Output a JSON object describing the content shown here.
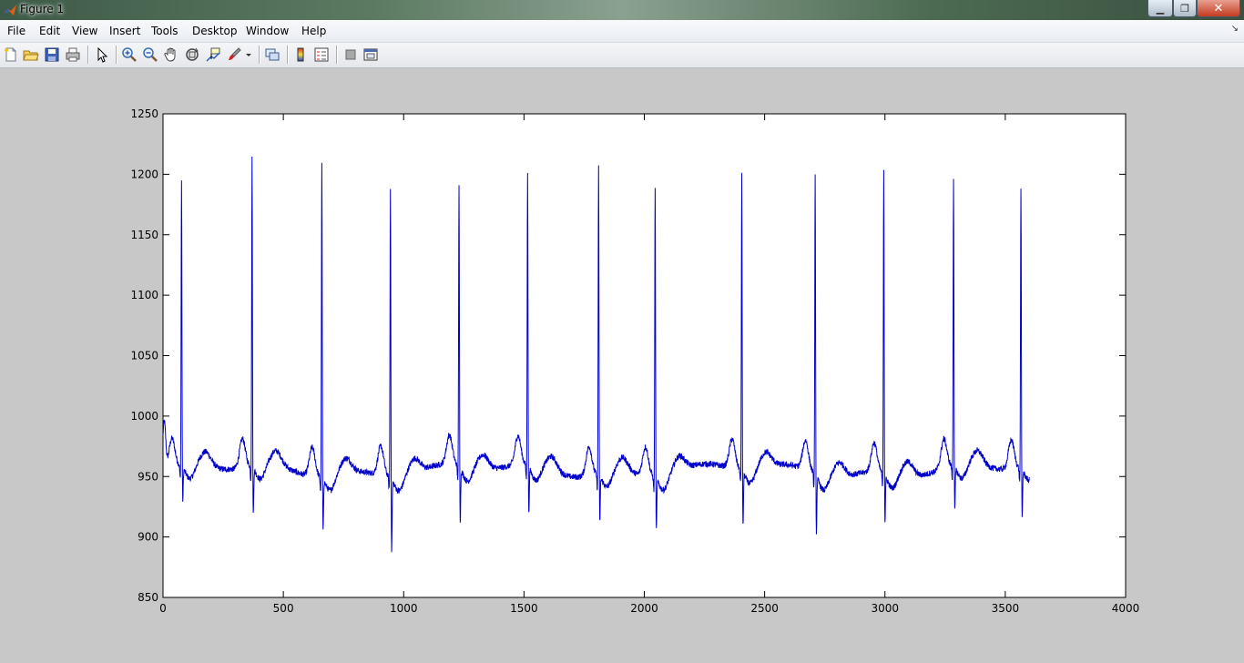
{
  "window": {
    "title": "Figure 1",
    "minimize_glyph": "▁",
    "maximize_glyph": "❐",
    "close_glyph": "✕"
  },
  "menu": {
    "items": [
      "File",
      "Edit",
      "View",
      "Insert",
      "Tools",
      "Desktop",
      "Window",
      "Help"
    ],
    "dock_glyph": "↘"
  },
  "toolbar": {
    "icons": [
      "new-figure-icon",
      "open-file-icon",
      "save-icon",
      "print-icon",
      "edit-plot-arrow-icon",
      "zoom-in-icon",
      "zoom-out-icon",
      "pan-hand-icon",
      "rotate-3d-icon",
      "data-cursor-icon",
      "brush-icon",
      "link-plot-icon",
      "insert-colorbar-icon",
      "insert-legend-icon",
      "hide-plot-tools-icon",
      "show-plot-tools-icon"
    ]
  },
  "colors": {
    "line": "#0000cc",
    "figure_bg": "#c8c8c8",
    "axes_bg": "#ffffff"
  },
  "chart_data": {
    "type": "line",
    "title": "",
    "xlabel": "",
    "ylabel": "",
    "xlim": [
      0,
      4000
    ],
    "ylim": [
      850,
      1250
    ],
    "xticks": [
      0,
      500,
      1000,
      1500,
      2000,
      2500,
      3000,
      3500,
      4000
    ],
    "yticks": [
      850,
      900,
      950,
      1000,
      1050,
      1100,
      1150,
      1200,
      1250
    ],
    "grid": false,
    "legend": false,
    "series": [
      {
        "color": "#0000cc",
        "baseline": 955,
        "n_samples": 3600,
        "beats": [
          {
            "x": 77,
            "peak": 1193,
            "trough": 927
          },
          {
            "x": 370,
            "peak": 1212,
            "trough": 916
          },
          {
            "x": 660,
            "peak": 1216,
            "trough": 910
          },
          {
            "x": 945,
            "peak": 1197,
            "trough": 895
          },
          {
            "x": 1230,
            "peak": 1188,
            "trough": 911
          },
          {
            "x": 1515,
            "peak": 1201,
            "trough": 915
          },
          {
            "x": 1810,
            "peak": 1213,
            "trough": 916
          },
          {
            "x": 2045,
            "peak": 1199,
            "trough": 911
          },
          {
            "x": 2405,
            "peak": 1201,
            "trough": 909
          },
          {
            "x": 2710,
            "peak": 1203,
            "trough": 907
          },
          {
            "x": 2995,
            "peak": 1209,
            "trough": 915
          },
          {
            "x": 3285,
            "peak": 1197,
            "trough": 918
          },
          {
            "x": 3565,
            "peak": 1191,
            "trough": 915
          }
        ]
      }
    ]
  }
}
